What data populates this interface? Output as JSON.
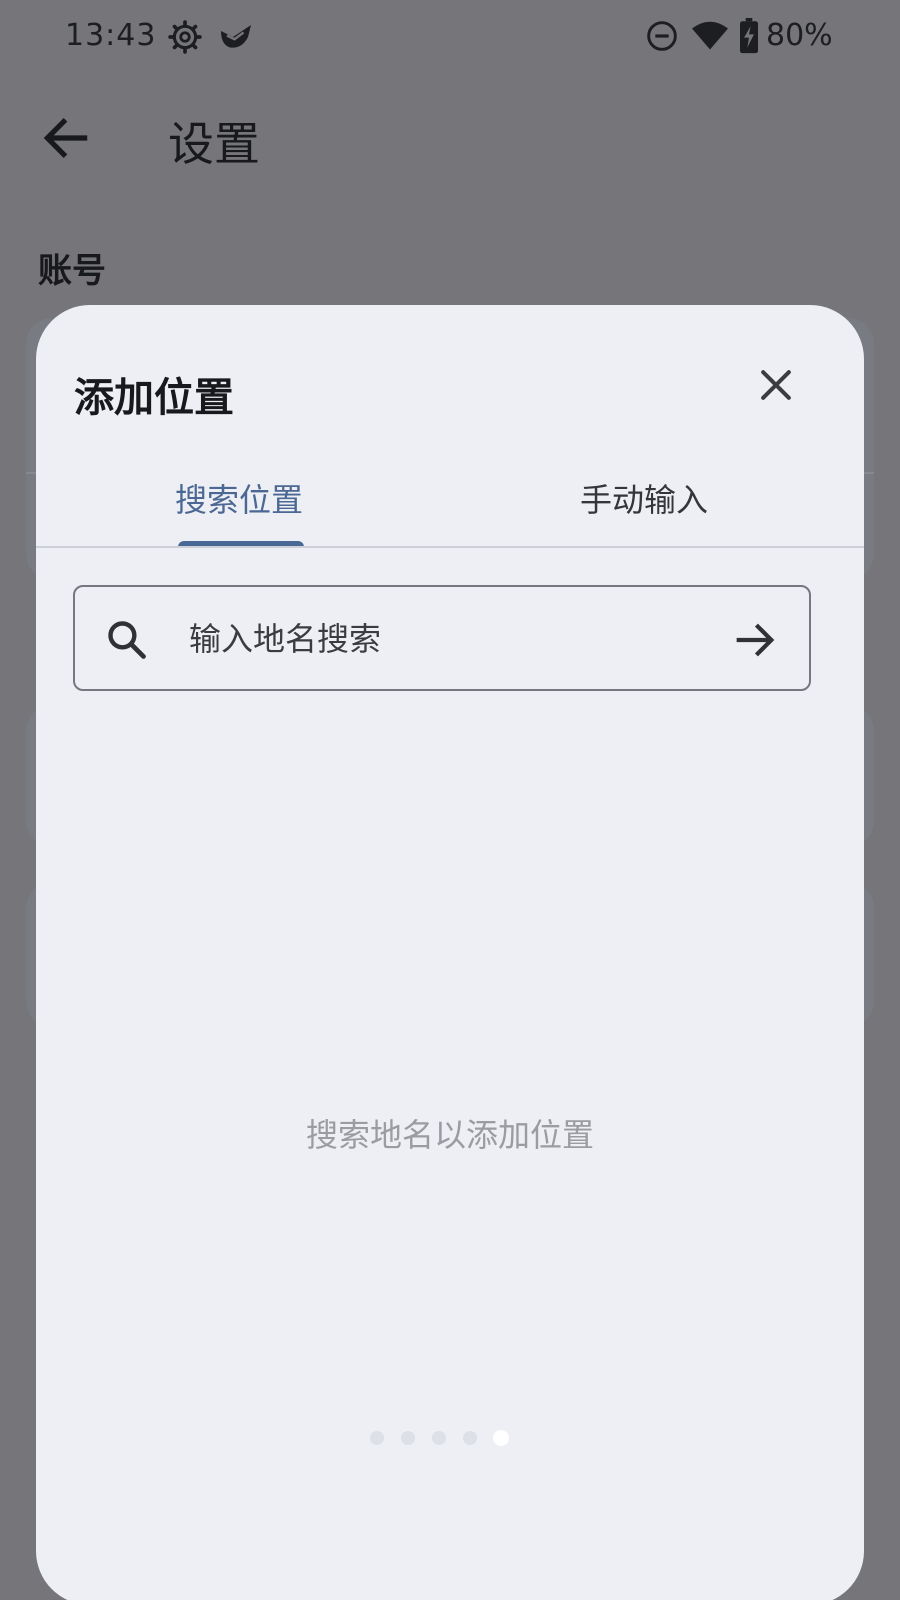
{
  "status_bar": {
    "time": "13:43",
    "battery": "80%",
    "icons": [
      "gear-icon",
      "app-notification-icon",
      "do-not-disturb-icon",
      "wifi-icon",
      "battery-charging-icon"
    ]
  },
  "header": {
    "title": "设置",
    "back_icon": "arrow-back-icon"
  },
  "background": {
    "section_title": "账号"
  },
  "sheet": {
    "title": "添加位置",
    "close_icon": "close-icon",
    "tabs": [
      {
        "label": "搜索位置",
        "selected": true
      },
      {
        "label": "手动输入",
        "selected": false
      }
    ],
    "search": {
      "placeholder": "输入地名搜索",
      "value": "",
      "search_icon": "search-icon",
      "submit_icon": "arrow-forward-icon"
    },
    "empty_message": "搜索地名以添加位置",
    "pager": {
      "count": 5,
      "active_index": 4
    }
  },
  "colors": {
    "scrim": "#75757a",
    "sheet_background": "#edeff4",
    "accent": "#4a6896",
    "hint_text": "#9a9ca2"
  }
}
